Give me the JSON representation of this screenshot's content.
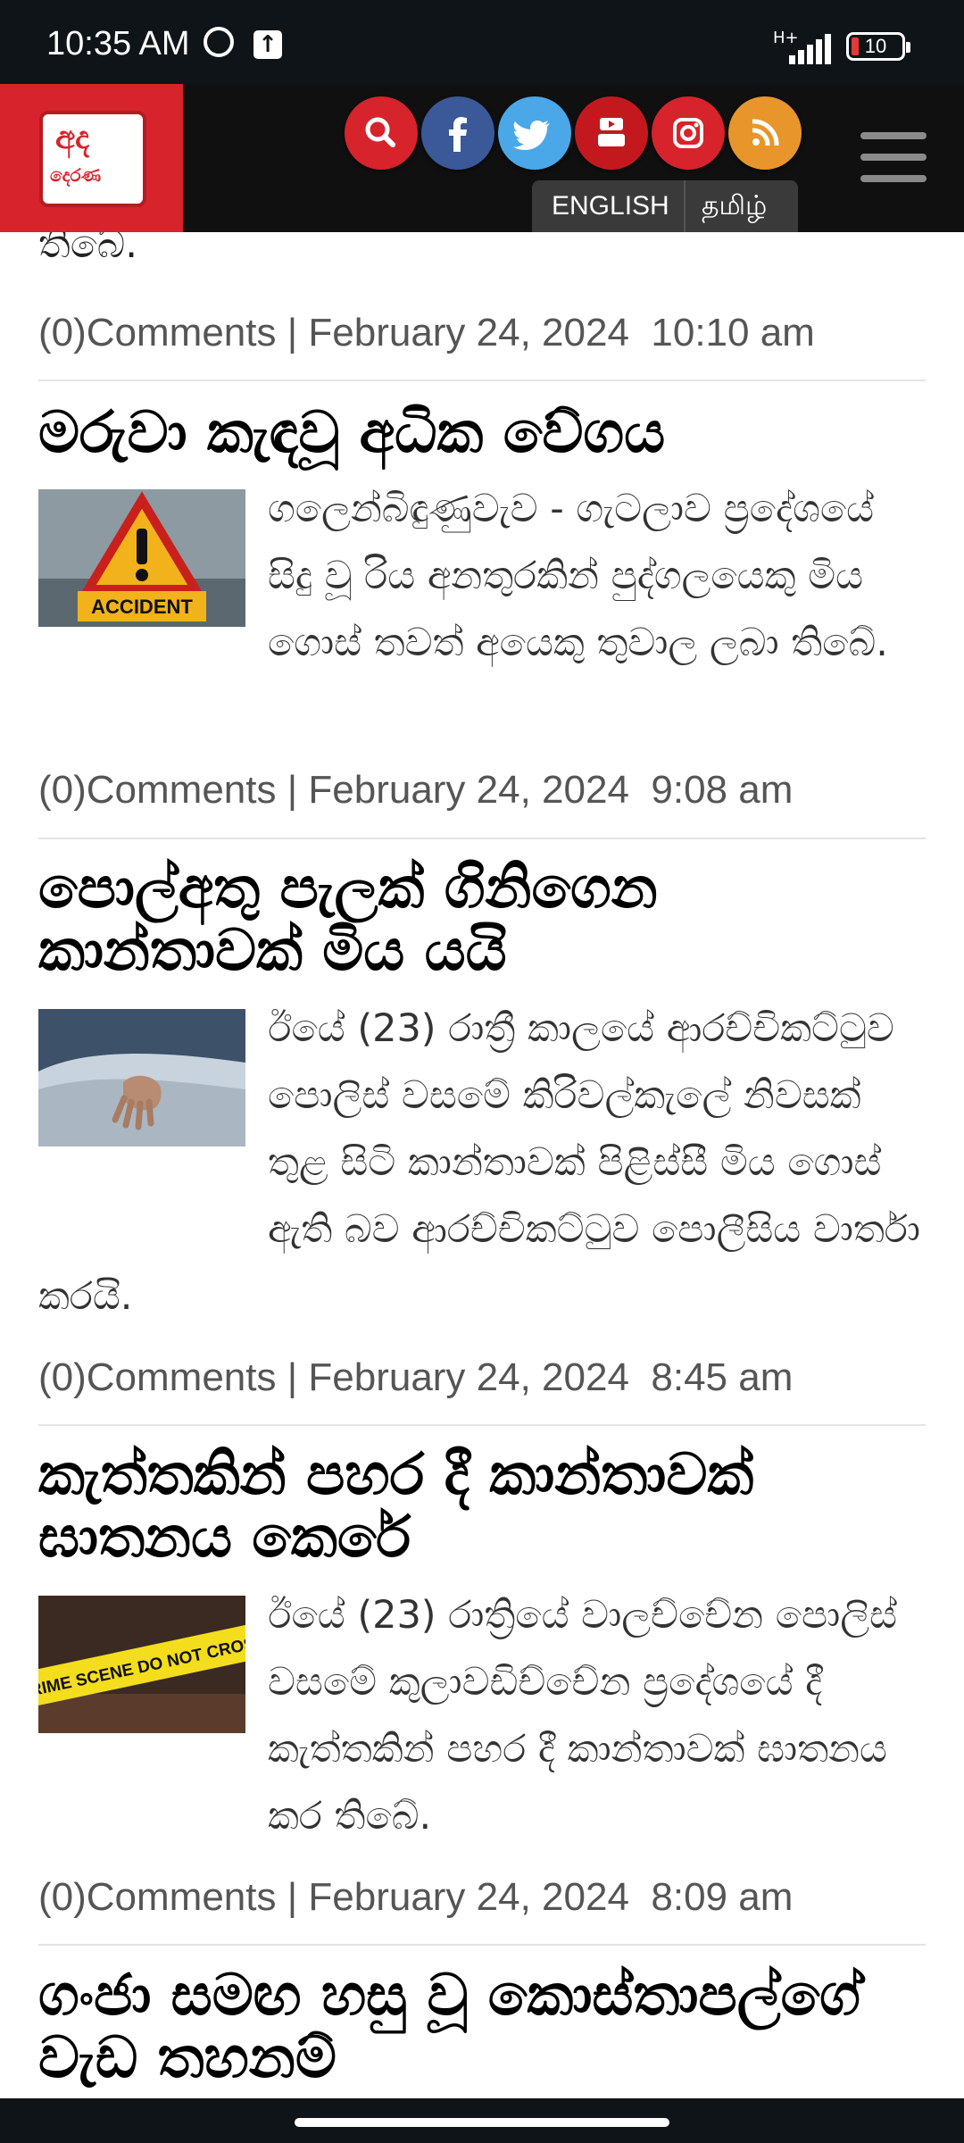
{
  "status_bar": {
    "time": "10:35 AM",
    "network": "H+",
    "battery": "10",
    "icons": [
      "alarm-icon",
      "upload-icon",
      "signal-icon",
      "battery-icon"
    ]
  },
  "header": {
    "logo_line1": "අද",
    "logo_line2": "දෙරණ",
    "social": [
      "search",
      "facebook",
      "twitter",
      "youtube",
      "instagram",
      "rss"
    ],
    "lang_english": "ENGLISH",
    "lang_tamil": "தமிழ்",
    "colors": {
      "logo_bg": "#d7232b",
      "search": "#d7232b",
      "facebook": "#3b5998",
      "twitter": "#4aa8e8",
      "youtube": "#c4181f",
      "instagram": "#d7232b",
      "rss": "#e8962b"
    }
  },
  "feed": {
    "fragment": "තිබේ.",
    "prev_meta": "(0)Comments | February 24, 2024  10:10 am",
    "articles": [
      {
        "title": "මරුවා කැඳවූ අධික වේගය",
        "summary": "ගලෙන්බිඳුණුවැව - ගැටලාව ප්‍රදේශයේ සිදු වූ රිය අනතුරකින් පුද්ගලයෙකු මිය ගොස් තවත් අයෙකු තුවාල ලබා තිබේ.",
        "meta": "(0)Comments | February 24, 2024  9:08 am",
        "image_text": "ACCIDENT"
      },
      {
        "title": "පොල්අතු පැලක් ගිනිගෙන කාන්තාවක් මිය යයි",
        "summary": "ඊයේ (23) රාත්‍රී කාලයේ ආරච්චිකට්ටුව පොලිස් වසමේ කිරිවල්කැලේ නිවසක් තුළ සිටි කාන්තාවක් පිළිස්සී මිය ගොස් ඇති බව ආරච්චිකට්ටුව පොලීසිය වාර්තා කරයි.",
        "meta": "(0)Comments | February 24, 2024  8:45 am"
      },
      {
        "title": "කැත්තකින් පහර දී කාන්තාවක් ඝාතනය කෙරේ",
        "summary": "ඊයේ (23) රාත්‍රියේ වාලච්චේන පොලිස් වසමේ කුලාවඩිච්චේන ප්‍රදේශයේ දී කැත්තකින් පහර දී කාන්තාවක් ඝාතනය කර තිබේ.",
        "meta": "(0)Comments | February 24, 2024  8:09 am",
        "image_text": "CRIME SCENE DO NOT CROSS"
      },
      {
        "title": "ගංජා සමඟ හසු වූ කොස්තාපල්ගේ වැඩ තහනම්"
      }
    ]
  }
}
